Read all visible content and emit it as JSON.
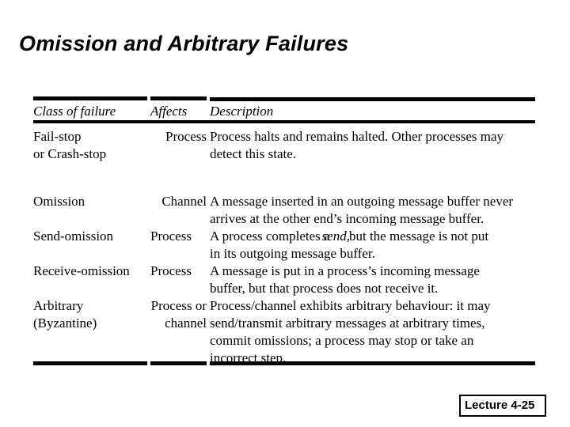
{
  "slide": {
    "title": "Omission and Arbitrary Failures",
    "footer_badge": "Lecture 4-25"
  },
  "table": {
    "headers": {
      "class_of_failure": "Class of failure",
      "affects": "Affects",
      "description": "Description"
    },
    "rows": [
      {
        "class_line1": "Fail-stop",
        "class_line2": "or Crash-stop",
        "affects": "Process",
        "desc_line1": "Process halts and remains halted. Other processes may",
        "desc_line2": "detect this state."
      },
      {
        "class_line1": "Omission",
        "class_line2": "",
        "affects": "Channel",
        "desc_line1": "A message inserted in an outgoing message buffer never",
        "desc_line2": "arrives at the other end’s incoming message buffer."
      },
      {
        "class_line1": "Send-omission",
        "class_line2": "",
        "affects": "Process",
        "desc_line1_a": "A process completes a",
        "desc_line1_italic": "send,",
        "desc_line1_b": "but the message is not put",
        "desc_line2": "in its outgoing message buffer."
      },
      {
        "class_line1": "Receive-omission",
        "class_line2": "",
        "affects": "Process",
        "desc_line1": "A message is put in a process’s incoming message",
        "desc_line2": "buffer, but that process does not receive it."
      },
      {
        "class_line1": "Arbitrary",
        "class_line2": "(Byzantine)",
        "affects_line1": "Process or",
        "affects_line2": "channel",
        "desc_line1": "Process/channel exhibits arbitrary behaviour: it may",
        "desc_line2": "send/transmit arbitrary messages at arbitrary times,",
        "desc_line3": "commit omissions; a process may stop or take an",
        "desc_line4": "incorrect step."
      }
    ]
  },
  "colors": {
    "background": "#ffffff",
    "text": "#000000",
    "rule": "#000000"
  }
}
